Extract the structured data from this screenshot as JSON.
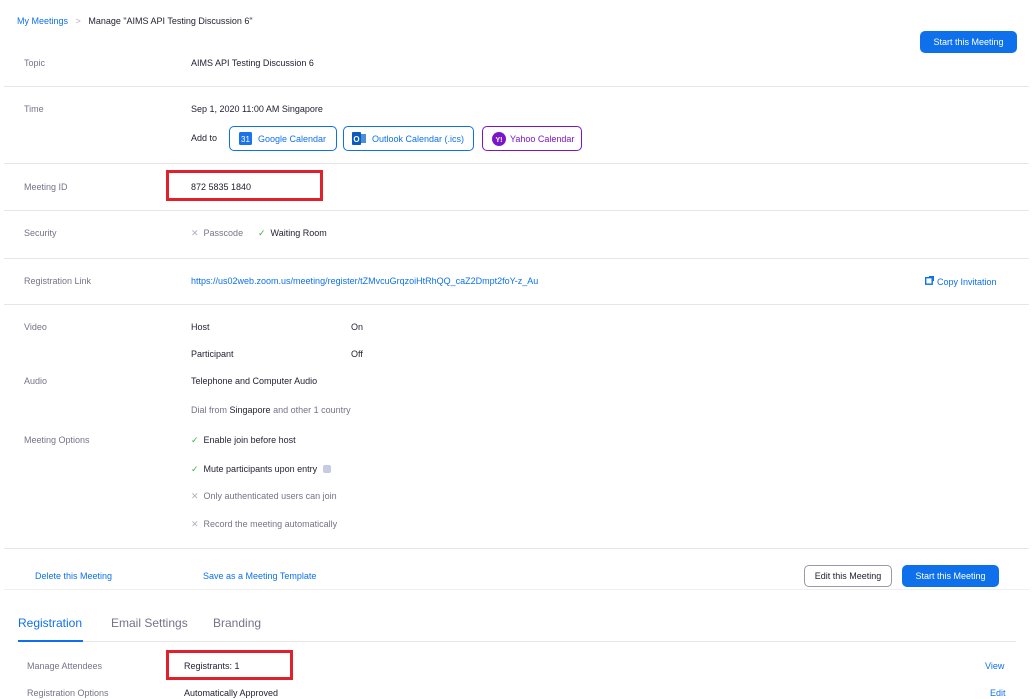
{
  "breadcrumb": {
    "root": "My Meetings",
    "separator": ">",
    "current": "Manage \"AIMS API Testing Discussion 6\""
  },
  "header": {
    "start_button": "Start this Meeting"
  },
  "topic": {
    "label": "Topic",
    "value": "AIMS API Testing Discussion 6"
  },
  "time": {
    "label": "Time",
    "value": "Sep 1, 2020 11:00 AM Singapore",
    "add_to_label": "Add to",
    "calendars": {
      "google": "Google Calendar",
      "outlook": "Outlook Calendar (.ics)",
      "yahoo": "Yahoo Calendar",
      "google_icon_text": "31",
      "yahoo_icon_text": "Y!"
    }
  },
  "meeting_id": {
    "label": "Meeting ID",
    "value": "872 5835 1840"
  },
  "security": {
    "label": "Security",
    "passcode": "Passcode",
    "waiting_room": "Waiting Room"
  },
  "registration_link": {
    "label": "Registration Link",
    "url": "https://us02web.zoom.us/meeting/register/tZMvcuGrqzoiHtRhQQ_caZ2Dmpt2foY-z_Au",
    "copy": "Copy Invitation"
  },
  "video": {
    "label": "Video",
    "host_label": "Host",
    "host_value": "On",
    "participant_label": "Participant",
    "participant_value": "Off"
  },
  "audio": {
    "label": "Audio",
    "value": "Telephone and Computer Audio",
    "dial_prefix": "Dial from",
    "dial_country": "Singapore",
    "dial_suffix": "and other 1 country"
  },
  "meeting_options": {
    "label": "Meeting Options",
    "items": [
      {
        "text": "Enable join before host",
        "enabled": true
      },
      {
        "text": "Mute participants upon entry",
        "enabled": true
      },
      {
        "text": "Only authenticated users can join",
        "enabled": false
      },
      {
        "text": "Record the meeting automatically",
        "enabled": false
      }
    ]
  },
  "actions": {
    "delete": "Delete this Meeting",
    "save_template": "Save as a Meeting Template",
    "edit": "Edit this Meeting",
    "start": "Start this Meeting"
  },
  "tabs": [
    {
      "label": "Registration",
      "active": true
    },
    {
      "label": "Email Settings",
      "active": false
    },
    {
      "label": "Branding",
      "active": false
    }
  ],
  "registration": {
    "manage_label": "Manage Attendees",
    "registrants": "Registrants: 1",
    "view": "View",
    "options_label": "Registration Options",
    "options_value": "Automatically Approved",
    "edit": "Edit"
  },
  "colors": {
    "accent": "#0e71eb",
    "yahoo": "#7b16c8",
    "highlight": "#e0202b",
    "check": "#3bb244"
  }
}
